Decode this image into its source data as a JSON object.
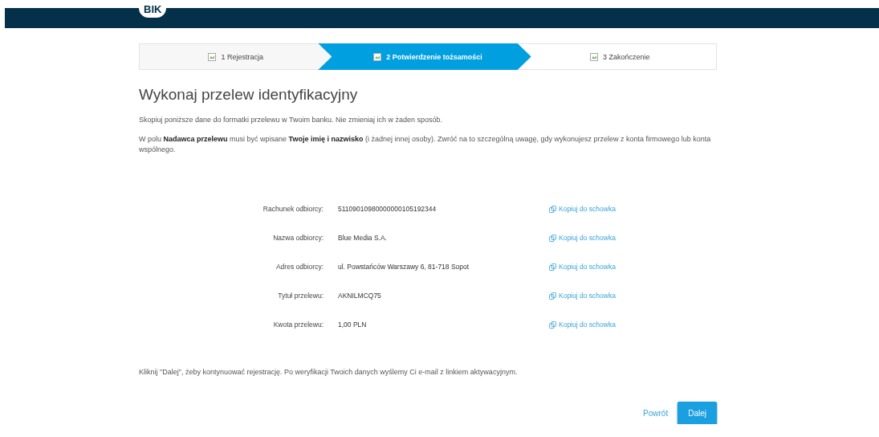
{
  "header": {
    "logo": "BIK"
  },
  "steps": [
    {
      "number": "1",
      "label": "Rejestracja",
      "selected": false
    },
    {
      "number": "2",
      "label": "Potwierdzenie tożsamości",
      "selected": true
    },
    {
      "number": "3",
      "label": "Zakończenie",
      "selected": false
    }
  ],
  "title": "Wykonaj przelew identyfikacyjny",
  "paragraphs": [
    "Skopiuj poniższe dane do formatki przelewu w Twoim banku. Nie zmieniaj ich w żaden sposób.",
    "W polu **Nadawca przelewu** musi być wpisane **Twoje imię i nazwisko** (i żadnej innej osoby). Zwróć na to szczególną uwagę, gdy wykonujesz przelew z konta firmowego lub konta wspólnego."
  ],
  "transfer_details": [
    {
      "label": "Rachunek odbiorcy:",
      "value": "51109010980000000105192344",
      "action": "Kopiuj do schowka"
    },
    {
      "label": "Nazwa odbiorcy:",
      "value": "Blue Media S.A.",
      "action": "Kopiuj do schowka"
    },
    {
      "label": "Adres odbiorcy:",
      "value": "ul. Powstańców Warszawy 6, 81-718 Sopot",
      "action": "Kopiuj do schowka"
    },
    {
      "label": "Tytuł przelewu:",
      "value": "AKNILMCQ75",
      "action": "Kopiuj do schowka"
    },
    {
      "label": "Kwota przelewu:",
      "value": "1,00 PLN",
      "action": "Kopiuj do schowka"
    }
  ],
  "footer_note": "Kliknij \"Dalej\", żeby kontynuować rejestrację. Po weryfikacji Twoich danych wyślemy Ci e-mail z linkiem aktywacyjnym.",
  "buttons": [
    {
      "label": "Powrót",
      "kind": "link"
    },
    {
      "label": "Dalej",
      "kind": "primary"
    }
  ]
}
